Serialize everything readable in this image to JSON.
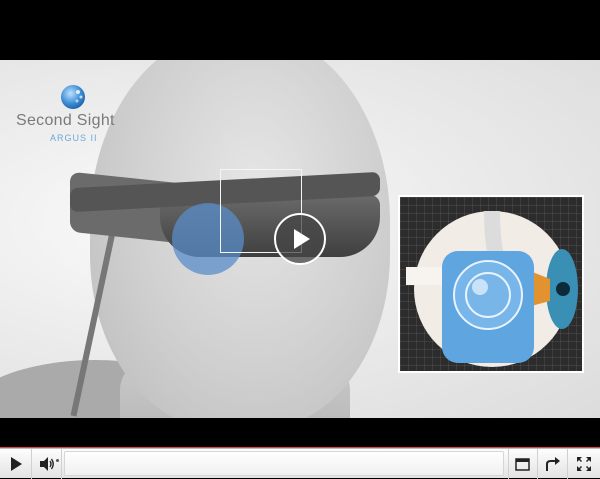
{
  "logo": {
    "title": "Second Sight",
    "subtitle": "ARGUS II",
    "accent_color": "#6fa6d8"
  },
  "video": {
    "state": "paused",
    "play_icon": "play-icon",
    "overlay_color": "#5a8cc8"
  },
  "controls": {
    "play_icon": "play-icon",
    "volume_icon": "volume-icon",
    "progress_fraction": 0,
    "progress_color": "#cf3a3a",
    "popout_icon": "popout-window-icon",
    "share_icon": "share-icon",
    "fullscreen_icon": "fullscreen-icon"
  }
}
